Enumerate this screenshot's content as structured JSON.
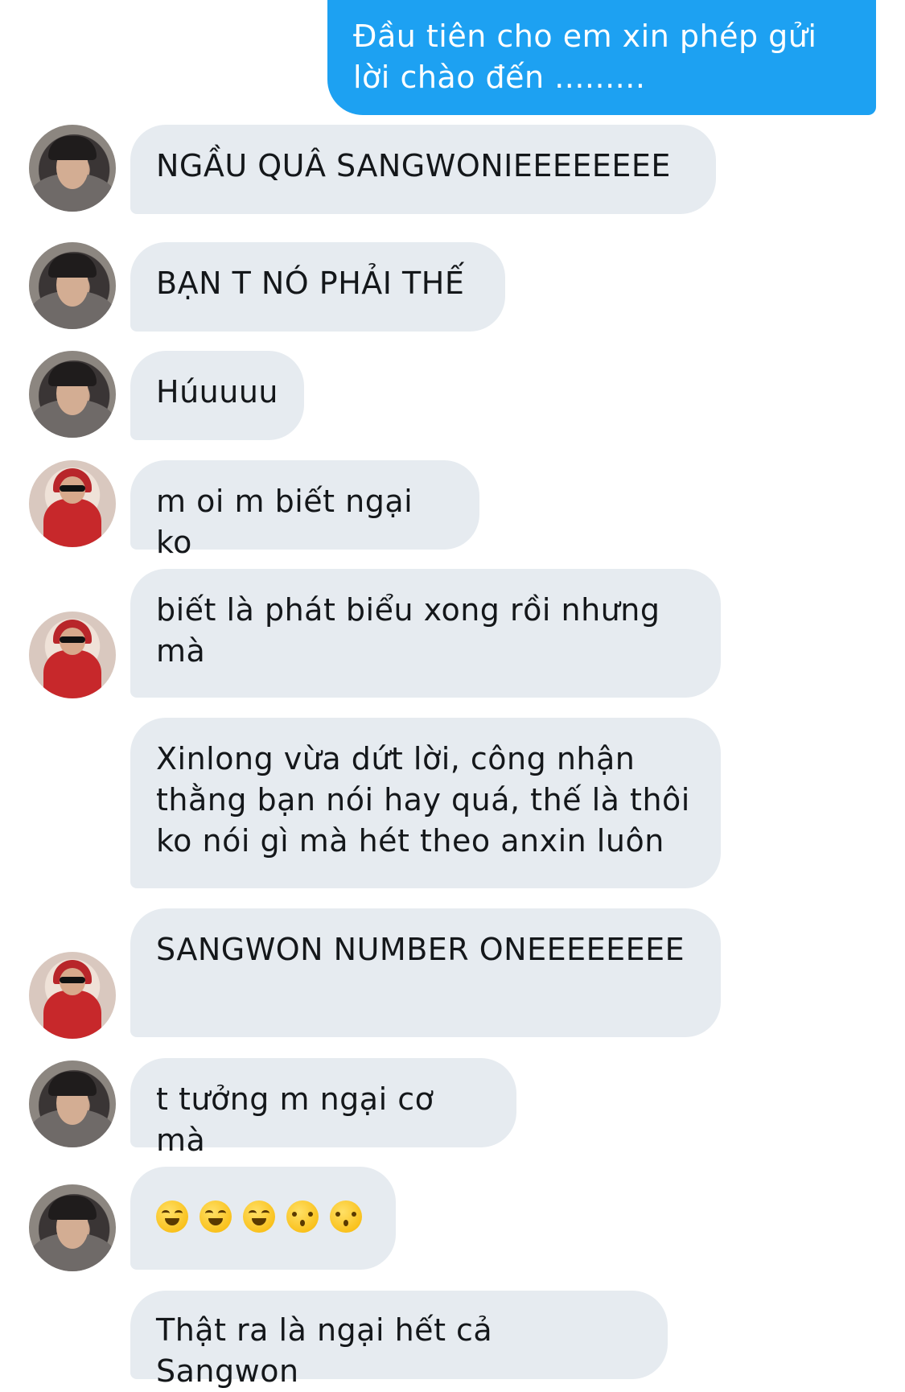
{
  "messages": [
    {
      "from": "me",
      "text": "Đầu tiên cho em xin phép gửi lời chào đến ........."
    },
    {
      "from": "user_a",
      "text": "NGẦU QUÂ SANGWONIEEEEEEEE"
    },
    {
      "from": "user_a",
      "text": "BẠN T NÓ PHẢI THẾ"
    },
    {
      "from": "user_a",
      "text": "Húuuuu"
    },
    {
      "from": "user_b",
      "text": "m oi m biết ngại ko"
    },
    {
      "from": "user_b",
      "text": "biết là phát biểu xong rồi nhưng mà"
    },
    {
      "from": "user_b",
      "text": "Xinlong vừa dứt lời, công nhận thằng bạn nói hay quá, thế là thôi ko nói gì mà hét theo anxin luôn"
    },
    {
      "from": "user_b",
      "text": "SANGWON NUMBER ONEEEEEEEE"
    },
    {
      "from": "user_a",
      "text": "t tưởng m ngại cơ mà"
    },
    {
      "from": "user_a",
      "emojis": [
        "laughing-emoji",
        "laughing-emoji",
        "laughing-emoji",
        "kissing-emoji",
        "kissing-emoji"
      ]
    },
    {
      "from": "user_a",
      "text": "Thật ra là ngại hết cả Sangwon"
    }
  ],
  "colors": {
    "sent_bubble": "#1da1f2",
    "received_bubble": "#e6ebf0"
  }
}
